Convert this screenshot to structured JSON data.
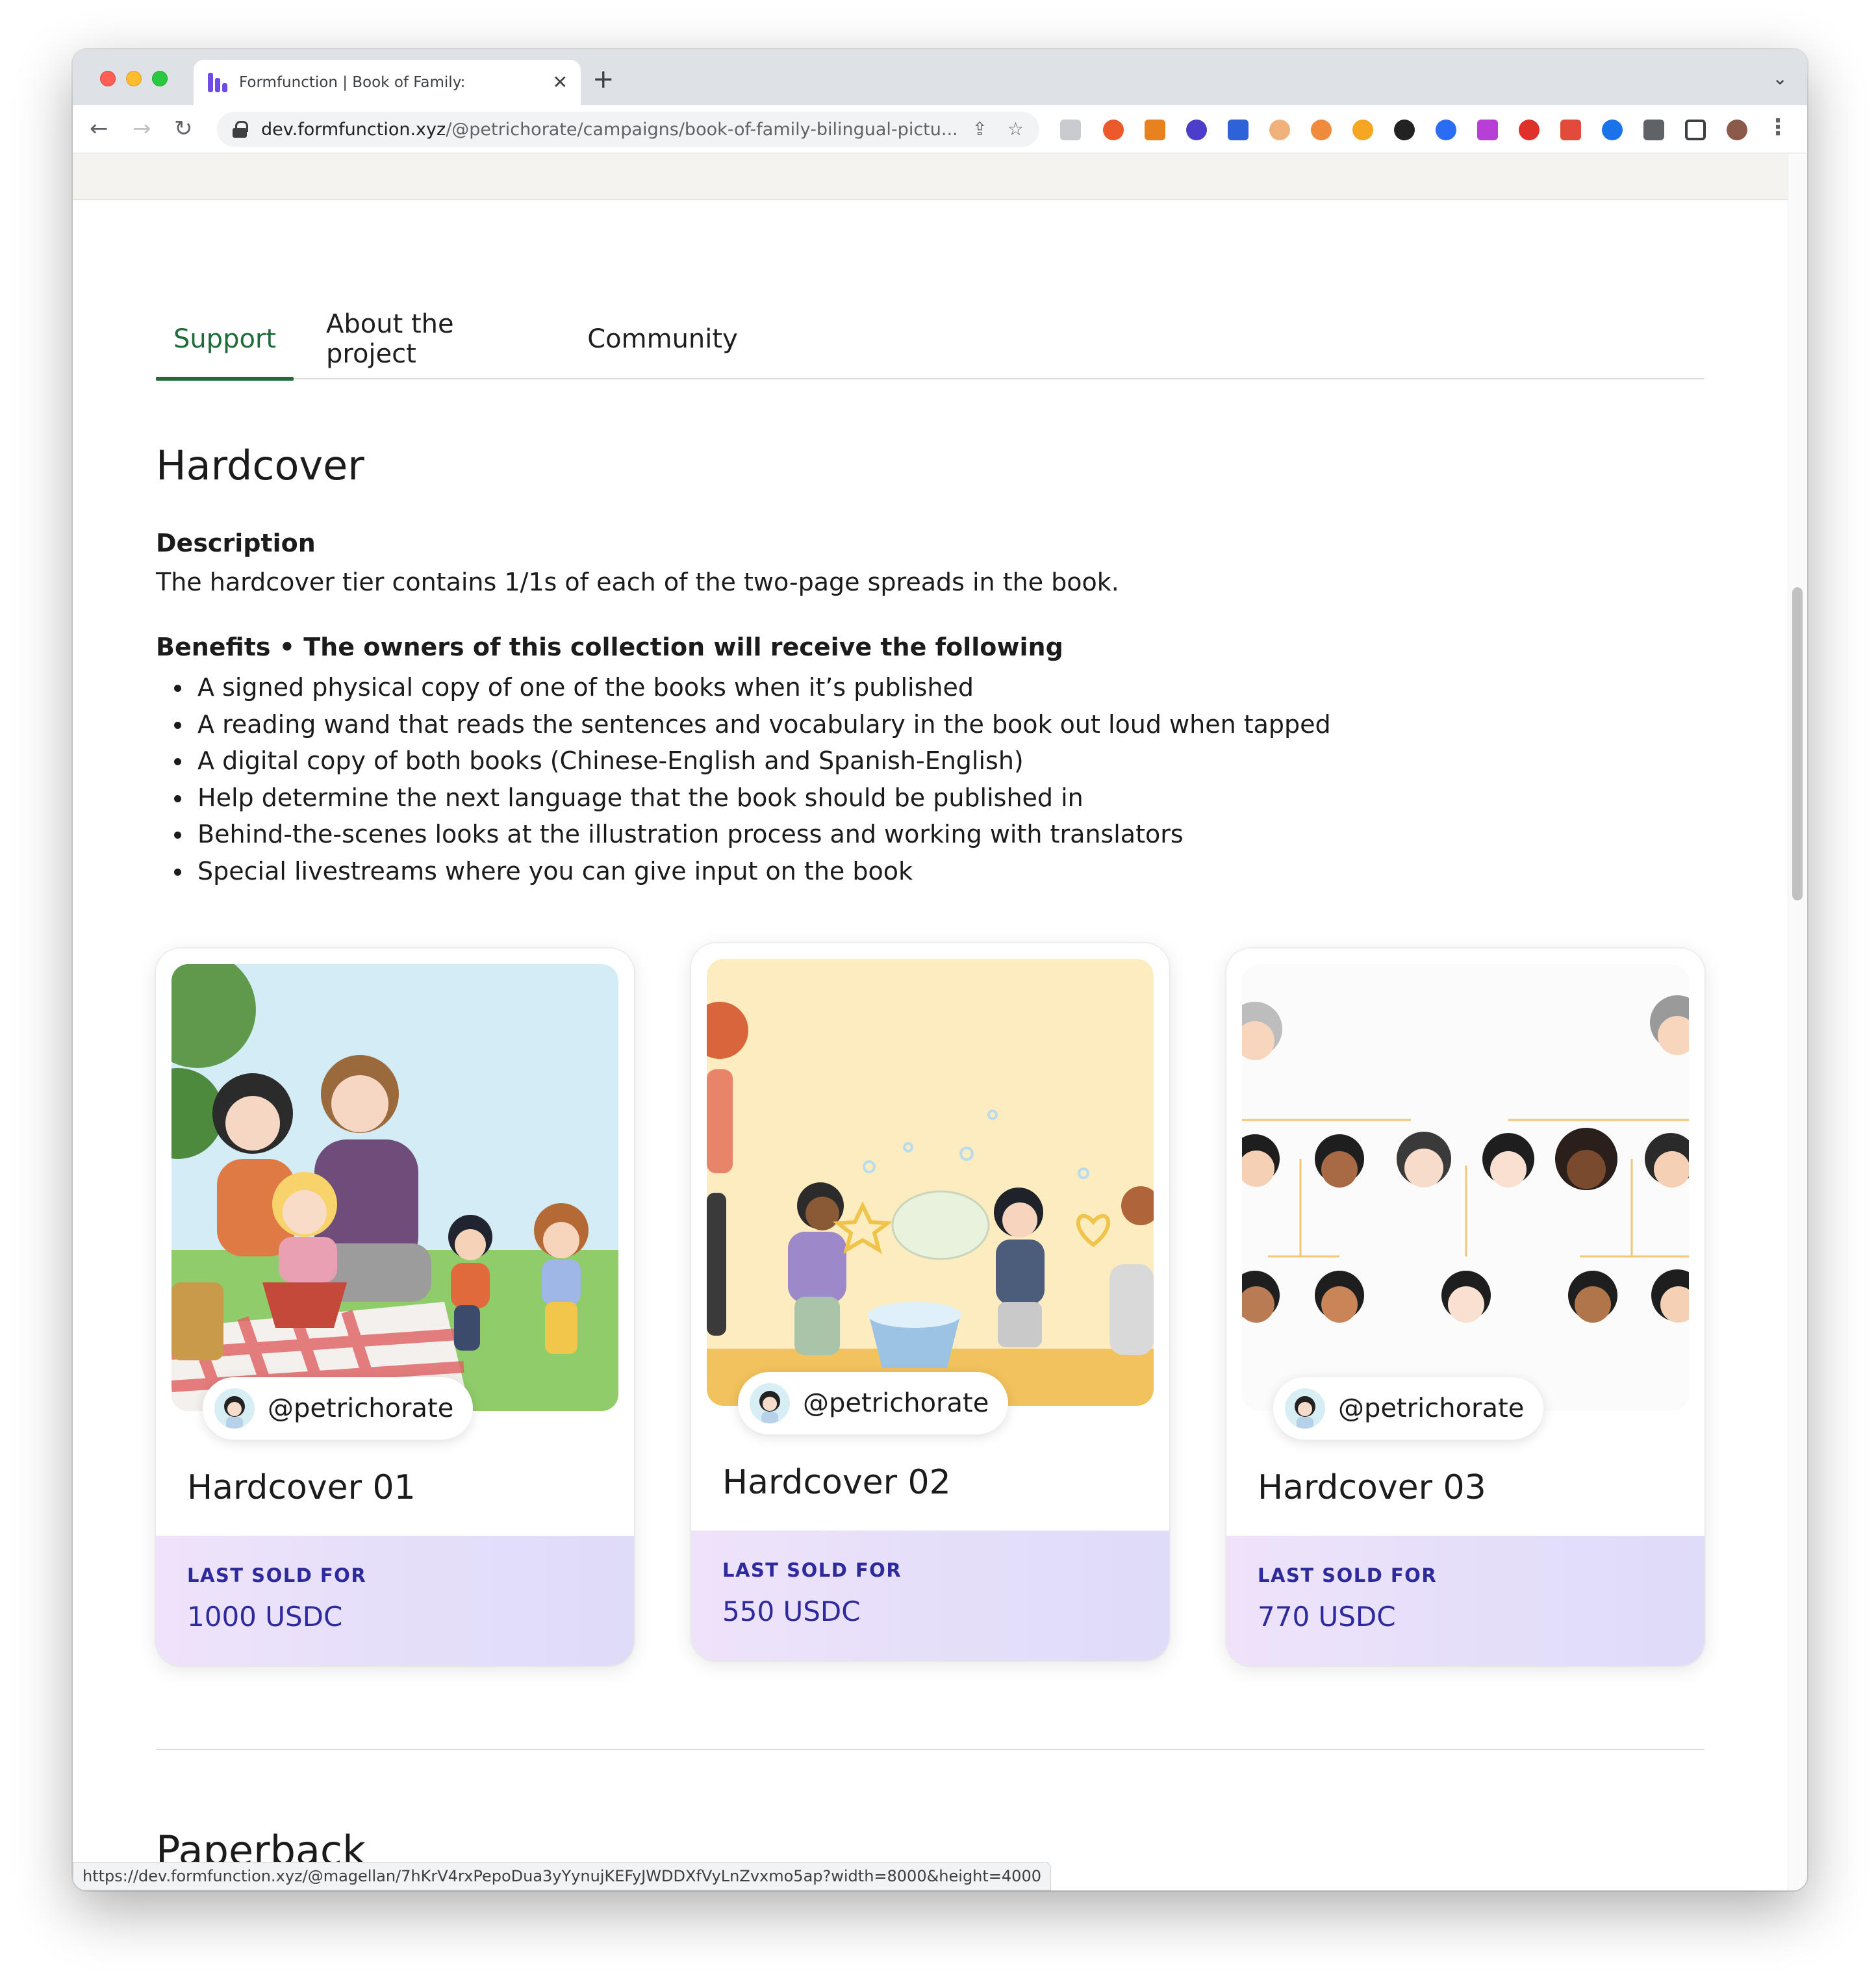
{
  "browser": {
    "tab_title": "Formfunction | Book of Family:",
    "url_host": "dev.formfunction.xyz",
    "url_path": "/@petrichorate/campaigns/book-of-family-bilingual-pictu...",
    "status_url": "https://dev.formfunction.xyz/@magellan/7hKrV4rxPepoDua3yYynujKEFyJWDDXfVyLnZvxmo5ap?width=8000&height=4000"
  },
  "page_tabs": [
    {
      "label": "Support",
      "active": true
    },
    {
      "label": "About the project",
      "active": false
    },
    {
      "label": "Community",
      "active": false
    }
  ],
  "tier": {
    "title": "Hardcover",
    "description_heading": "Description",
    "description": "The hardcover tier contains 1/1s of each of the two-page spreads in the book.",
    "benefits_heading": "Benefits • The owners of this collection will receive the following",
    "benefits": [
      "A signed physical copy of one of the books when it’s published",
      "A reading wand that reads the sentences and vocabulary in the book out loud when tapped",
      "A digital copy of both books (Chinese-English and Spanish-English)",
      "Help determine the next language that the book should be published in",
      "Behind-the-scenes looks at the illustration process and working with translators",
      "Special livestreams where you can give input on the book"
    ]
  },
  "cards": [
    {
      "title": "Hardcover 01",
      "creator": "@petrichorate",
      "label": "LAST SOLD FOR",
      "price": "1000 USDC"
    },
    {
      "title": "Hardcover 02",
      "creator": "@petrichorate",
      "label": "LAST SOLD FOR",
      "price": "550 USDC"
    },
    {
      "title": "Hardcover 03",
      "creator": "@petrichorate",
      "label": "LAST SOLD FOR",
      "price": "770 USDC"
    }
  ],
  "next_tier": {
    "title": "Paperback"
  },
  "colors": {
    "accent_green": "#1f6b3a",
    "price_indigo": "#2d2a9e",
    "brand_purple": "#6e4ce6"
  }
}
